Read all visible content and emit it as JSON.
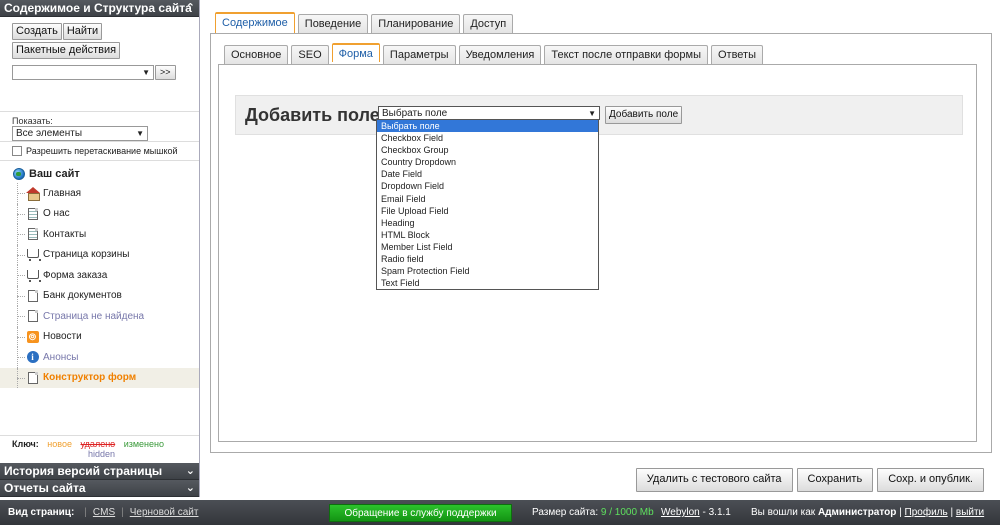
{
  "sidebar": {
    "title": "Содержимое и Структура сайта",
    "toggle_icon": "chevron-up-double-icon",
    "create_label": "Создать",
    "find_label": "Найти",
    "batch_label": "Пакетные действия",
    "go_label": ">>",
    "show_label": "Показать:",
    "show_value": "Все элементы",
    "drag_label": "Разрешить перетаскивание мышкой",
    "tree": {
      "root": "Ваш сайт",
      "items": [
        {
          "label": "Главная",
          "icon": "home-icon"
        },
        {
          "label": "О нас",
          "icon": "page-icon"
        },
        {
          "label": "Контакты",
          "icon": "page-icon"
        },
        {
          "label": "Страница корзины",
          "icon": "cart-icon"
        },
        {
          "label": "Форма заказа",
          "icon": "cart-icon"
        },
        {
          "label": "Банк документов",
          "icon": "page-icon"
        },
        {
          "label": "Страница не найдена",
          "icon": "page-icon"
        },
        {
          "label": "Новости",
          "icon": "rss-icon"
        },
        {
          "label": "Анонсы",
          "icon": "info-icon"
        },
        {
          "label": "Конструктор форм",
          "icon": "page-icon"
        }
      ]
    },
    "legend": {
      "key": "Ключ:",
      "new": "новое",
      "deleted": "удалено",
      "changed": "изменено",
      "hidden": "hidden"
    },
    "history_title": "История версий страницы",
    "reports_title": "Отчеты сайта"
  },
  "main": {
    "top_tabs": [
      "Содержимое",
      "Поведение",
      "Планирование",
      "Доступ"
    ],
    "sub_tabs": [
      "Основное",
      "SEO",
      "Форма",
      "Параметры",
      "Уведомления",
      "Текст после отправки формы",
      "Ответы"
    ],
    "add_field_label": "Добавить поле",
    "select_value": "Выбрать поле",
    "add_field_button": "Добавить поле",
    "dropdown_options": [
      "Выбрать поле",
      "Checkbox Field",
      "Checkbox Group",
      "Country Dropdown",
      "Date Field",
      "Dropdown Field",
      "Email Field",
      "File Upload Field",
      "Heading",
      "HTML Block",
      "Member List Field",
      "Radio field",
      "Spam Protection Field",
      "Text Field"
    ],
    "actions": {
      "remove": "Удалить с тестового сайта",
      "save": "Сохранить",
      "publish": "Сохр. и опублик."
    }
  },
  "footer": {
    "view_label": "Вид страниц:",
    "cms": "CMS",
    "sep": "|",
    "draft": "Черновой сайт",
    "support": "Обращение в службу поддержки",
    "size_label": "Размер сайта:",
    "size_value": "9 / 1000 Mb",
    "product": "Webylon",
    "version": "3.1.1",
    "logged_in": "Вы вошли как",
    "user": "Администратор",
    "profile": "Профиль",
    "logout": "выйти"
  },
  "colors": {
    "accent": "#f0a030",
    "selected_option": "#3277d8",
    "support_green": "#139413",
    "link_blue": "#1f5fa8"
  }
}
